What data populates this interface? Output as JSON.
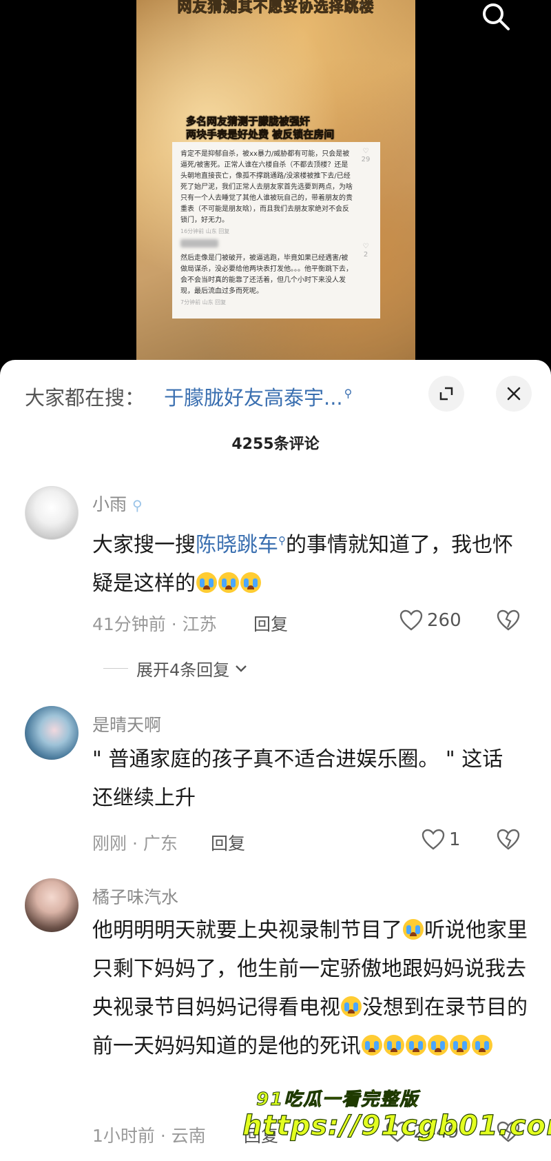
{
  "video": {
    "top_caption": "网友猜测其不愿妥协选择跳楼",
    "overlay_line1": "多名网友猜测于朦胧被强奸",
    "overlay_line2": "两块手表是好处费 被反锁在房间",
    "inner_comment1": "肯定不是抑郁自杀，被xx暴力/威胁都有可能，只会是被逼死/被害死。正常人谁在六楼自杀（不都去顶楼？还是头朝地直接丧亡，像孤不撑跳通路/没滚楼被推下去/已经死了始尸泥，我们正常人去朋友家首先选要到两点，为啥只有一个人去睡觉了其他人谁被玩自己的，带着朋友的贵重表（不可能是朋友晗），而且我们去朋友家绝对不会反锁门，好无力。",
    "inner_meta1": "16分钟前 山东 回复",
    "inner_comment2": "然后走像是门被破开，被逼逃跑，毕竟如果已经遇害/被做局谋杀，没必要给他两块表打发他。。。他平衡跳下去，会不会当时真的能靠了还活着，但几个小时下来没人发现，最后流血过多而死呢。",
    "inner_meta2": "7分钟前 山东 回复",
    "inner_likes1": "29",
    "inner_likes2": "2"
  },
  "header": {
    "trending_label": "大家都在搜：",
    "trending_link": "于朦胧好友高泰宇...",
    "comment_count": "4255条评论"
  },
  "comments": [
    {
      "username": "小雨",
      "text_before": "大家搜一搜",
      "text_link": "陈晓跳车",
      "text_after": "的事情就知道了，我也怀疑是这样的",
      "meta": "41分钟前 · 江苏",
      "reply": "回复",
      "likes": "260",
      "expand": "展开4条回复"
    },
    {
      "username": "是晴天啊",
      "text": "\" 普通家庭的孩子真不适合进娱乐圈。 \" 这话还继续上升",
      "meta": "刚刚 · 广东",
      "reply": "回复",
      "likes": "1"
    },
    {
      "username": "橘子味汽水",
      "text_part1": "他明明明天就要上央视录制节目了",
      "text_part2": "听说他家里只剩下妈妈了，他生前一定骄傲地跟妈妈说我去央视录节目妈妈记得看电视",
      "text_part3": "没想到在录节目的前一天妈妈知道的是他的死讯",
      "meta": "1小时前 · 云南",
      "reply": "回复",
      "likes": "2449"
    }
  ],
  "watermark": {
    "line1": "91吃瓜一看完整版",
    "line2": "https://91cgb01.com"
  },
  "icons": [
    "search-icon",
    "expand-icon",
    "close-icon",
    "heart-icon",
    "dislike-icon",
    "chevron-down-icon",
    "search-suggest-icon"
  ],
  "colors": {
    "link": "#3a6fb0",
    "emoji": "#ffcc33",
    "watermark": "#e3ff20"
  }
}
